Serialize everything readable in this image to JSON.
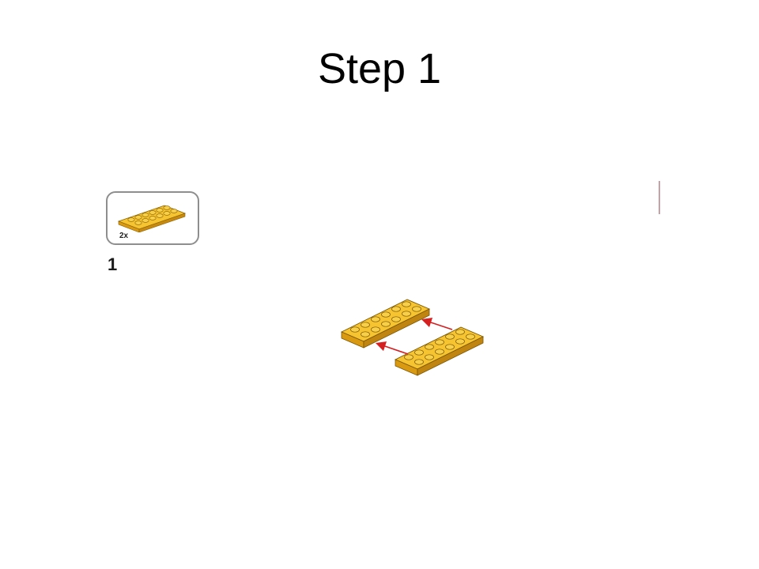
{
  "slide": {
    "title": "Step 1"
  },
  "instruction": {
    "step_number": "1",
    "parts_callout": {
      "quantity": "2x",
      "part_icon": "yellow-2x6-plate-icon"
    },
    "assembly_icon": "two-plates-join-icon"
  },
  "colors": {
    "brick_top": "#f5c430",
    "brick_side": "#d99a12",
    "brick_dark": "#b07a0a",
    "arrow": "#d42020",
    "callout_border": "#8e8e8e"
  }
}
